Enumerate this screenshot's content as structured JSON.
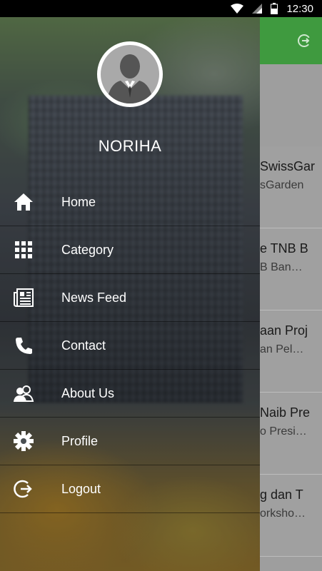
{
  "status_bar": {
    "time": "12:30",
    "icons": [
      "wifi-icon",
      "signal-icon",
      "battery-icon"
    ]
  },
  "background_app": {
    "toolbar_color": "#3f9a3f",
    "toolbar_icon": "logout-icon",
    "list_items": [
      {
        "title": "SwissGar",
        "subtitle": "sGarden"
      },
      {
        "title": "e TNB B",
        "subtitle": "B Ban…"
      },
      {
        "title": "aan Proj",
        "subtitle": "an Pel…"
      },
      {
        "title": "Naib Pre",
        "subtitle": "o Presi…"
      },
      {
        "title": "g dan T",
        "subtitle": "orksho…"
      }
    ]
  },
  "drawer": {
    "user_name": "NORIHA",
    "avatar_icon": "user-avatar-icon",
    "menu": [
      {
        "label": "Home",
        "icon": "home-icon"
      },
      {
        "label": "Category",
        "icon": "grid-icon"
      },
      {
        "label": "News Feed",
        "icon": "newspaper-icon"
      },
      {
        "label": "Contact",
        "icon": "phone-icon"
      },
      {
        "label": "About Us",
        "icon": "people-icon"
      },
      {
        "label": "Profile",
        "icon": "gear-icon"
      },
      {
        "label": "Logout",
        "icon": "logout-icon"
      }
    ]
  }
}
